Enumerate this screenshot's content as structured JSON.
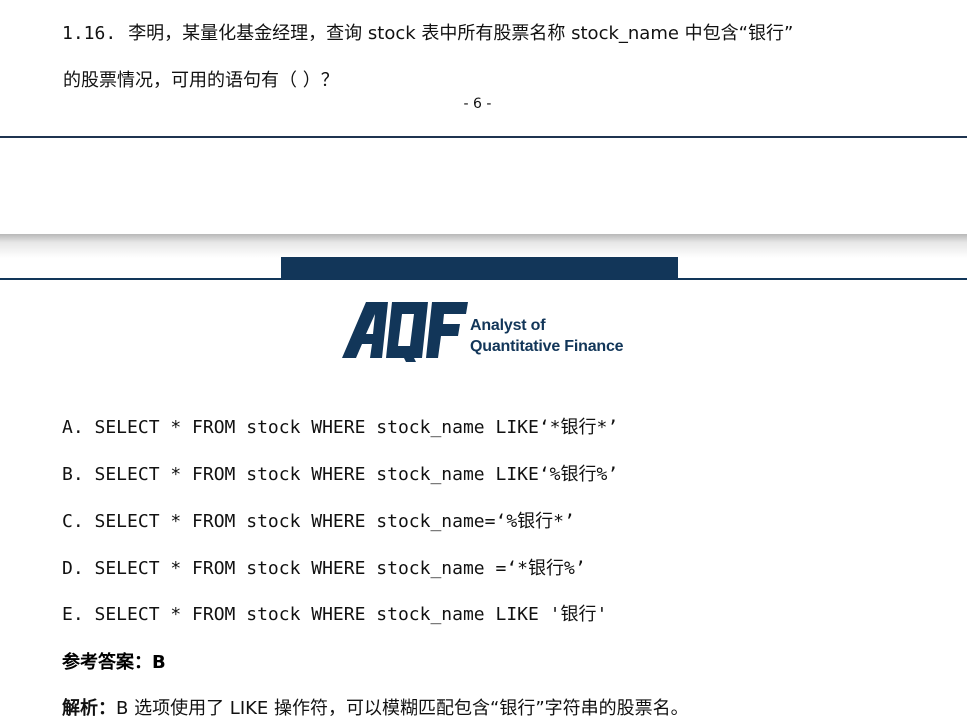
{
  "question": {
    "number": "1.16.",
    "line1": "李明，某量化基金经理，查询 stock 表中所有股票名称 stock_name 中包含“银行”",
    "line2": "的股票情况，可用的语句有（ ）？"
  },
  "page_number": "- 6 -",
  "logo": {
    "name": "AQF-logo",
    "letters": "AQF",
    "line1": "Analyst of",
    "line2": "Quantitative Finance",
    "color": "#123659"
  },
  "options": [
    "A. SELECT * FROM stock WHERE stock_name LIKE‘*银行*’",
    "B. SELECT * FROM stock WHERE stock_name LIKE‘%银行%’",
    "C. SELECT * FROM stock WHERE stock_name=‘%银行*’",
    "D. SELECT * FROM stock WHERE stock_name =‘*银行%’",
    "E. SELECT * FROM stock WHERE stock_name LIKE '银行'"
  ],
  "answer": {
    "label": "参考答案：",
    "value": "B"
  },
  "analysis": {
    "label": "解析：",
    "text": "B 选项使用了 LIKE 操作符，可以模糊匹配包含“银行”字符串的股票名。"
  }
}
